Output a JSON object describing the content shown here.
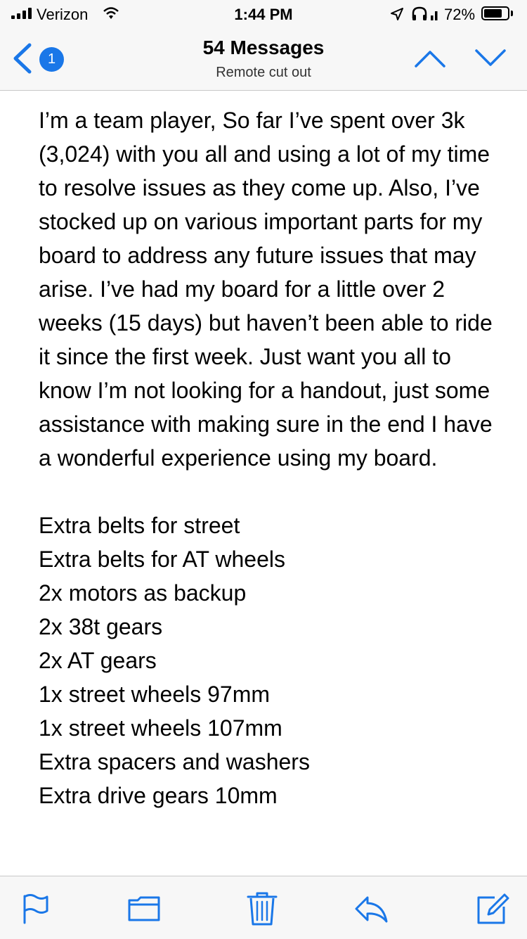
{
  "status_bar": {
    "carrier": "Verizon",
    "time": "1:44 PM",
    "battery_percent": "72%",
    "icons": [
      "signal-icon",
      "wifi-icon",
      "location-icon",
      "headphones-icon",
      "battery-icon"
    ]
  },
  "nav": {
    "back_badge_count": "1",
    "title": "54 Messages",
    "subtitle": "Remote cut out",
    "icons": [
      "back-chevron-icon",
      "previous-message-icon",
      "next-message-icon"
    ]
  },
  "message": {
    "paragraph": "I’m a team player, So far I’ve spent over 3k (3,024) with you all and using a lot of my time to resolve issues as they come up. Also, I’ve stocked up on various important parts for my board to address any future issues that may arise. I’ve had my board for a little over 2 weeks (15 days) but haven’t been able to ride it since the first week. Just want you all to know I’m not looking for a handout, just some assistance with making sure in the end I have a wonderful experience using my board.",
    "parts": [
      "Extra belts for street",
      "Extra belts for AT wheels",
      "2x motors as backup",
      "2x 38t gears",
      "2x AT gears",
      "1x street wheels 97mm",
      "1x street wheels 107mm",
      "Extra spacers and washers",
      "Extra drive gears 10mm"
    ]
  },
  "toolbar": {
    "icons": [
      "flag-icon",
      "folder-icon",
      "trash-icon",
      "reply-icon",
      "compose-icon"
    ]
  },
  "colors": {
    "accent": "#1a77e8",
    "bar_background": "#f7f7f7",
    "content_background": "#ffffff"
  }
}
